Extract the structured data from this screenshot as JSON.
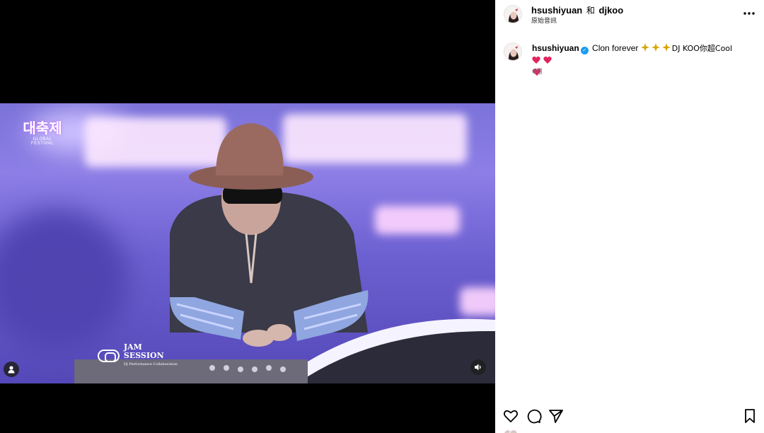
{
  "header": {
    "username_primary": "hsushiyuan",
    "conjunction": "和",
    "username_secondary": "djkoo",
    "subtitle": "原始音訊",
    "more_icon": "more-horizontal-icon"
  },
  "caption": {
    "username": "hsushiyuan",
    "verified": true,
    "text_1": "Clon forever",
    "text_2": "DJ KOO你超Cool",
    "emojis": [
      "sparkle-emoji",
      "heart-emoji"
    ],
    "time_ago": "6週"
  },
  "media": {
    "overlay_festival_text": "대축제",
    "overlay_festival_sub": "GLOBAL FESTIVAL",
    "overlay_jam_title": "JAM SESSION",
    "overlay_jam_sub": "DJ Performance Collaboration",
    "user_tag_icon": "user-icon",
    "audio_icon": "speaker-muted-icon"
  },
  "actions": {
    "like_icon": "heart-outline-icon",
    "comment_icon": "comment-icon",
    "share_icon": "send-icon",
    "save_icon": "bookmark-icon"
  },
  "colors": {
    "verified_blue": "#1d9bf0",
    "heart_red": "#e0245e",
    "muted_text": "#737373"
  }
}
